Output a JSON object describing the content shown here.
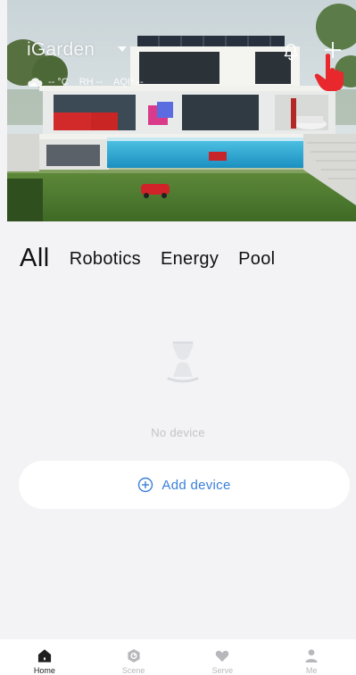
{
  "header": {
    "home_name": "iGarden",
    "weather": {
      "temperature": "-- °C",
      "humidity": "RH --",
      "aqi": "AQI* --"
    }
  },
  "tabs": [
    {
      "label": "All",
      "active": true
    },
    {
      "label": "Robotics",
      "active": false
    },
    {
      "label": "Energy",
      "active": false
    },
    {
      "label": "Pool",
      "active": false
    }
  ],
  "empty_state": {
    "message": "No device",
    "add_button_label": "Add device"
  },
  "bottom_nav": [
    {
      "label": "Home",
      "icon": "home-icon",
      "active": true
    },
    {
      "label": "Scene",
      "icon": "scene-icon",
      "active": false
    },
    {
      "label": "Serve",
      "icon": "heart-icon",
      "active": false
    },
    {
      "label": "Me",
      "icon": "person-icon",
      "active": false
    }
  ],
  "colors": {
    "accent": "#3a7fd9",
    "page_background": "#f3f3f5",
    "hand_pointer": "#e8282d"
  }
}
